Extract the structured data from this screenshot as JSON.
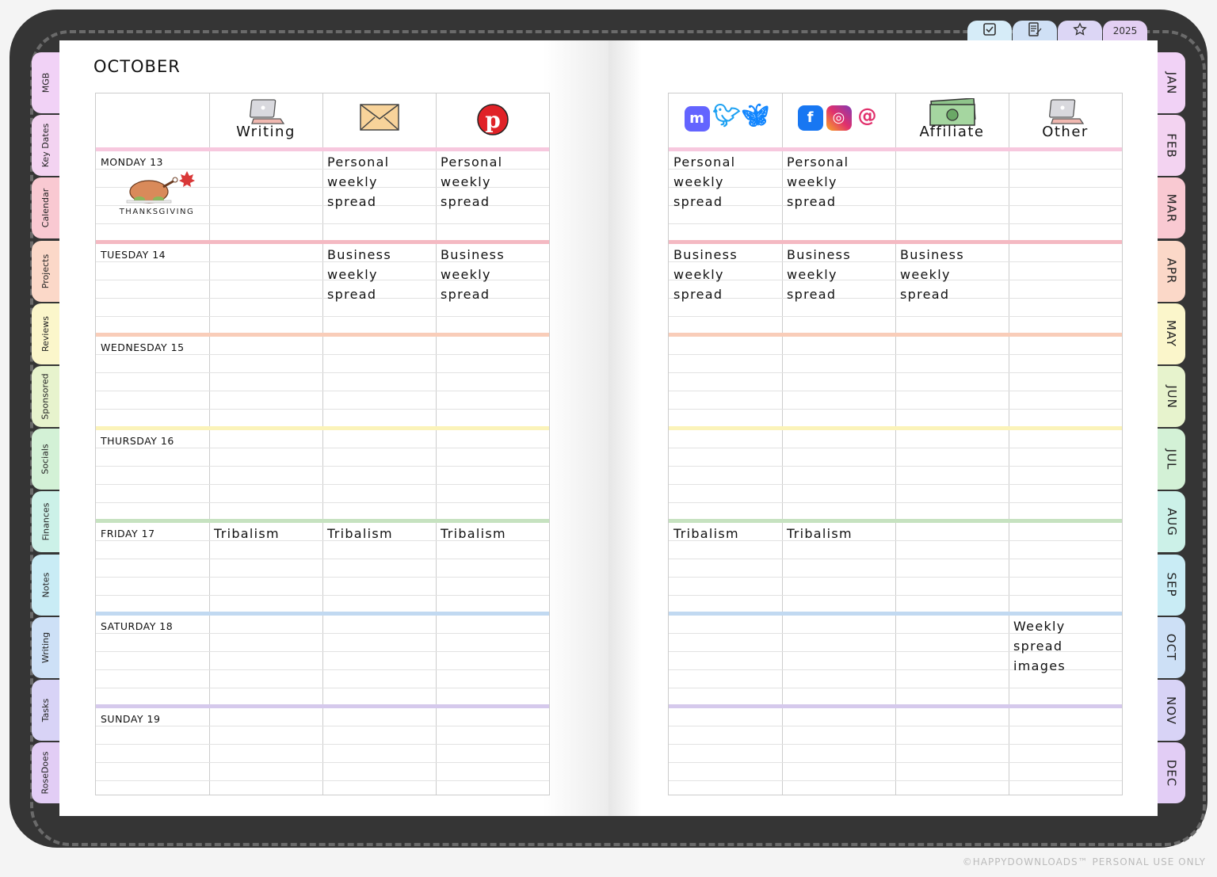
{
  "month_title": "OCTOBER",
  "top_tabs": [
    {
      "icon": "checkbox-icon",
      "color": "#d6ecf8"
    },
    {
      "icon": "notes-icon",
      "color": "#cfe0f5"
    },
    {
      "icon": "star-icon",
      "color": "#dcd6f5"
    },
    {
      "label": "2025",
      "color": "#e3cff3"
    }
  ],
  "left_tabs": [
    {
      "label": "MGB",
      "color": "#f1d2f6"
    },
    {
      "label": "Key Dates",
      "color": "#f3d3f1"
    },
    {
      "label": "Calendar",
      "color": "#f9c9d2"
    },
    {
      "label": "Projects",
      "color": "#fbd8c8"
    },
    {
      "label": "Reviews",
      "color": "#fbf6cb"
    },
    {
      "label": "Sponsored",
      "color": "#e7f3cd"
    },
    {
      "label": "Socials",
      "color": "#d3f1d6"
    },
    {
      "label": "Finances",
      "color": "#ccf1e8"
    },
    {
      "label": "Notes",
      "color": "#c9ecf5"
    },
    {
      "label": "Writing",
      "color": "#cde0f6"
    },
    {
      "label": "Tasks",
      "color": "#d8d3f6"
    },
    {
      "label": "RoseDoes",
      "color": "#e2cdf5"
    }
  ],
  "right_tabs": [
    {
      "label": "JAN",
      "color": "#f1d2f6"
    },
    {
      "label": "FEB",
      "color": "#f3d3f1"
    },
    {
      "label": "MAR",
      "color": "#f9c9d2"
    },
    {
      "label": "APR",
      "color": "#fbd8c8"
    },
    {
      "label": "MAY",
      "color": "#fbf6cb"
    },
    {
      "label": "JUN",
      "color": "#e7f3cd"
    },
    {
      "label": "JUL",
      "color": "#d3f1d6"
    },
    {
      "label": "AUG",
      "color": "#ccf1e8"
    },
    {
      "label": "SEP",
      "color": "#c9ecf5"
    },
    {
      "label": "OCT",
      "color": "#cde0f6"
    },
    {
      "label": "NOV",
      "color": "#d8d3f6"
    },
    {
      "label": "DEC",
      "color": "#e2cdf5"
    }
  ],
  "left_headers": [
    {
      "label": "",
      "icon": ""
    },
    {
      "label": "Writing",
      "icon": "laptop-icon"
    },
    {
      "label": "",
      "icon": "envelope-icon"
    },
    {
      "label": "",
      "icon": "pinterest-icon"
    }
  ],
  "right_headers": [
    {
      "label": "",
      "icon": "mastodon-twitter-bluesky-icons"
    },
    {
      "label": "",
      "icon": "facebook-instagram-threads-icons"
    },
    {
      "label": "Affiliate",
      "icon": "money-icon"
    },
    {
      "label": "Other",
      "icon": "laptop-icon"
    }
  ],
  "thanksgiving_label": "THANKSGIVING",
  "days": [
    {
      "label": "MONDAY 13",
      "color": "#f7c8de",
      "left": [
        "",
        "Personal\nweekly\nspread",
        "Personal\nweekly\nspread"
      ],
      "right": [
        "Personal\nweekly\nspread",
        "Personal\nweekly\nspread",
        "",
        ""
      ]
    },
    {
      "label": "TUESDAY 14",
      "color": "#f4b9c2",
      "left": [
        "",
        "Business\nweekly\nspread",
        "Business\nweekly\nspread"
      ],
      "right": [
        "Business\nweekly\nspread",
        "Business\nweekly\nspread",
        "Business\nweekly\nspread",
        ""
      ]
    },
    {
      "label": "WEDNESDAY 15",
      "color": "#f9cdb9",
      "left": [
        "",
        "",
        ""
      ],
      "right": [
        "",
        "",
        "",
        ""
      ]
    },
    {
      "label": "THURSDAY 16",
      "color": "#fbf3b9",
      "left": [
        "",
        "",
        ""
      ],
      "right": [
        "",
        "",
        "",
        ""
      ]
    },
    {
      "label": "FRIDAY 17",
      "color": "#c6e2c0",
      "left": [
        "Tribalism",
        "Tribalism",
        "Tribalism"
      ],
      "right": [
        "Tribalism",
        "Tribalism",
        "",
        ""
      ]
    },
    {
      "label": "SATURDAY 18",
      "color": "#c1d9f1",
      "left": [
        "",
        "",
        ""
      ],
      "right": [
        "",
        "",
        "",
        "Weekly\nspread\nimages"
      ]
    },
    {
      "label": "SUNDAY 19",
      "color": "#d5c9ec",
      "left": [
        "",
        "",
        ""
      ],
      "right": [
        "",
        "",
        "",
        ""
      ]
    }
  ],
  "watermark": "©HAPPYDOWNLOADS™ PERSONAL USE ONLY"
}
